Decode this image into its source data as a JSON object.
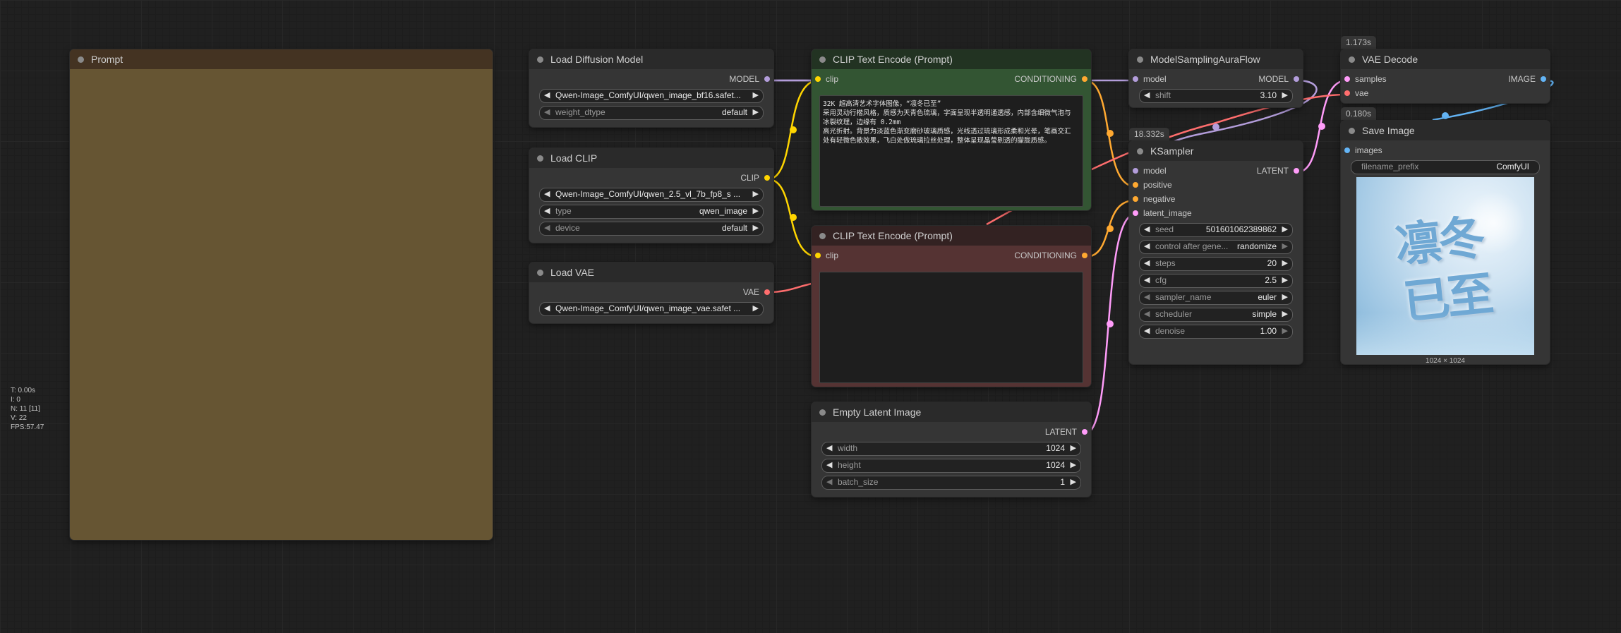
{
  "stats": [
    "T: 0.00s",
    "I: 0",
    "N: 11 [11]",
    "V: 22",
    "FPS:57.47"
  ],
  "prompt_node": {
    "title": "Prompt"
  },
  "load_diffusion": {
    "title": "Load Diffusion Model",
    "output": "MODEL",
    "unet_name": "Qwen-Image_ComfyUI/qwen_image_bf16.safet...",
    "weight_dtype_label": "weight_dtype",
    "weight_dtype_value": "default"
  },
  "load_clip": {
    "title": "Load CLIP",
    "output": "CLIP",
    "clip_name": "Qwen-Image_ComfyUI/qwen_2.5_vl_7b_fp8_s ...",
    "type_label": "type",
    "type_value": "qwen_image",
    "device_label": "device",
    "device_value": "default"
  },
  "load_vae": {
    "title": "Load VAE",
    "output": "VAE",
    "vae_name": "Qwen-Image_ComfyUI/qwen_image_vae.safet ..."
  },
  "clip_pos": {
    "title": "CLIP Text Encode (Prompt)",
    "input": "clip",
    "output": "CONDITIONING",
    "text": "32K 超高清艺术字体图像，“凛冬已至”\n采用灵动行楷风格，质感为天青色琉璃，字面呈现半透明通透感，内部含细微气泡与\n冰裂纹理，边缘有 0.2mm\n高光折射。背景为淡蓝色渐变磨砂玻璃质感，光线透过琉璃形成柔和光晕，笔画交汇\n处有轻微色散效果，飞白处做琉璃拉丝处理，整体呈现晶莹剔透的朦胧质感。"
  },
  "clip_neg": {
    "title": "CLIP Text Encode (Prompt)",
    "input": "clip",
    "output": "CONDITIONING"
  },
  "empty_latent": {
    "title": "Empty Latent Image",
    "output": "LATENT",
    "width_label": "width",
    "width_value": "1024",
    "height_label": "height",
    "height_value": "1024",
    "batch_label": "batch_size",
    "batch_value": "1"
  },
  "model_sampling": {
    "title": "ModelSamplingAuraFlow",
    "input": "model",
    "output": "MODEL",
    "shift_label": "shift",
    "shift_value": "3.10"
  },
  "ksampler": {
    "badge": "18.332s",
    "title": "KSampler",
    "inputs": [
      "model",
      "positive",
      "negative",
      "latent_image"
    ],
    "output": "LATENT",
    "seed_label": "seed",
    "seed_value": "501601062389862",
    "control_label": "control after gene...",
    "control_value": "randomize",
    "steps_label": "steps",
    "steps_value": "20",
    "cfg_label": "cfg",
    "cfg_value": "2.5",
    "sampler_label": "sampler_name",
    "sampler_value": "euler",
    "scheduler_label": "scheduler",
    "scheduler_value": "simple",
    "denoise_label": "denoise",
    "denoise_value": "1.00"
  },
  "vae_decode": {
    "badge": "1.173s",
    "title": "VAE Decode",
    "inputs": [
      "samples",
      "vae"
    ],
    "output": "IMAGE"
  },
  "save_image": {
    "badge": "0.180s",
    "title": "Save Image",
    "input": "images",
    "prefix_label": "filename_prefix",
    "prefix_value": "ComfyUI",
    "image_text_line1": "凛冬",
    "image_text_line2": "已至",
    "image_size": "1024 × 1024"
  },
  "colors": {
    "model": "#b39ddb",
    "clip": "#ffd500",
    "vae": "#ff6e6e",
    "conditioning": "#ffa931",
    "latent": "#ff9cf9",
    "image": "#64b5f6",
    "prompt_fill": "#665533",
    "prompt_title": "#443322",
    "pos_fill": "#335533",
    "pos_title": "#223322",
    "neg_fill": "#553333",
    "neg_title": "#332222"
  }
}
